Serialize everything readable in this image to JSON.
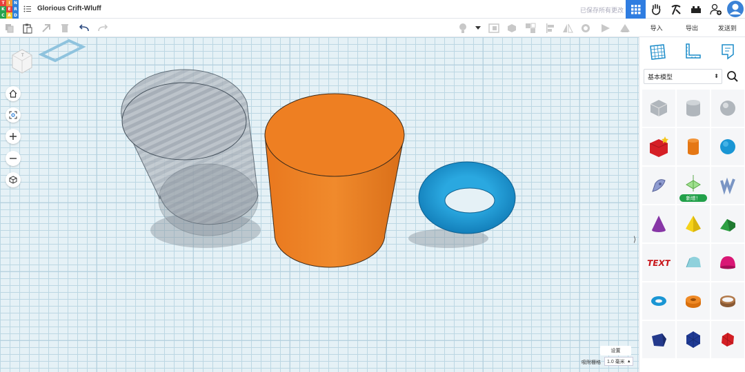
{
  "app": {
    "logo_letters": [
      "T",
      "I",
      "N",
      "K",
      "E",
      "R",
      "C",
      "A",
      "D"
    ],
    "logo_colors": [
      "#e8413b",
      "#f09a3a",
      "#2c7fd9",
      "#27a34f",
      "#e8413b",
      "#2c7fd9",
      "#27a34f",
      "#f0c52e",
      "#2c7fd9"
    ],
    "document_title": "Glorious Crift-Wluff",
    "save_status": "已保存所有更改"
  },
  "top_icons": [
    "grid-view-icon",
    "tinker-hand-icon",
    "pickaxe-icon",
    "bricks-icon",
    "add-user-icon",
    "profile-avatar-icon"
  ],
  "toolbar": {
    "left_icons": [
      "copy-icon",
      "paste-icon",
      "duplicate-icon",
      "delete-icon",
      "undo-icon",
      "redo-icon"
    ],
    "right_icons": [
      "light-bulb-icon",
      "dropdown-caret-icon",
      "shape-icon",
      "hole-icon",
      "group-icon",
      "ungroup-icon",
      "align-icon",
      "mirror-icon",
      "cruise-icon",
      "flag-icon",
      "workplane-icon"
    ]
  },
  "actions": {
    "import_label": "导入",
    "export_label": "导出",
    "send_label": "发送到"
  },
  "panel": {
    "tool_icons": [
      "workplane-grid-icon",
      "ruler-icon",
      "notes-icon"
    ],
    "category_value": "基本模型",
    "new_badge": "新增！",
    "shapes": [
      "box-hole",
      "cylinder-hole",
      "sphere-hole",
      "box",
      "cylinder",
      "sphere",
      "scribble",
      "spinner-new",
      "text-shape",
      "cone",
      "pyramid",
      "roof",
      "text",
      "half-cylinder",
      "paraboloid",
      "torus",
      "tube",
      "ring",
      "polygon",
      "icosahedron",
      "polyhedron"
    ]
  },
  "view_controls": [
    "home-view-icon",
    "fit-view-icon",
    "zoom-in-icon",
    "zoom-out-icon",
    "ortho-view-icon"
  ],
  "workplane": {
    "settings_label": "设置",
    "snap_label": "吸附栅格",
    "snap_value": "1.0 毫米"
  },
  "colors": {
    "accent": "#2f7de1",
    "workplane": "#e5f1f6",
    "cylinder": "#ee7f22",
    "torus": "#1a98d5",
    "hole": "#9aa3ad"
  }
}
